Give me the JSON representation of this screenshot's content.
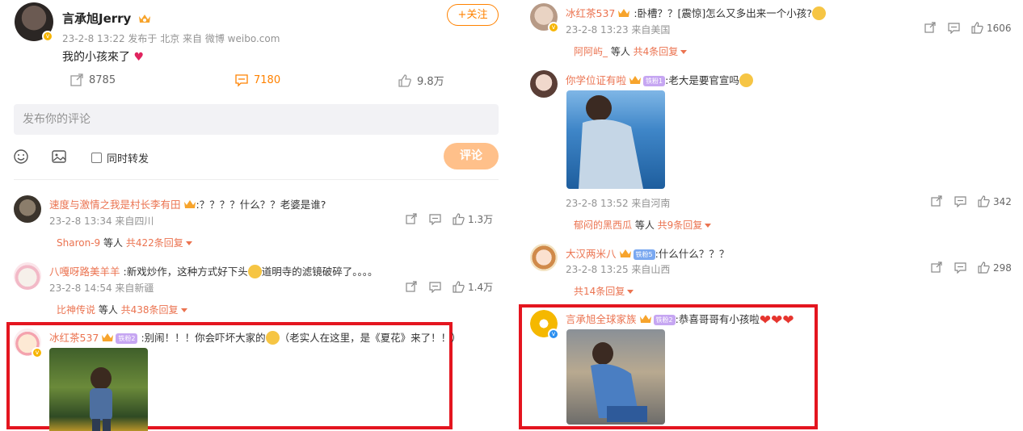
{
  "post": {
    "username": "言承旭Jerry",
    "meta": "23-2-8 13:22  发布于 北京  来自 微博 weibo.com",
    "text": "我的小孩來了",
    "follow_label": "+关注",
    "reposts": "8785",
    "comments": "7180",
    "likes": "9.8万"
  },
  "composer": {
    "placeholder": "发布你的评论",
    "repost_label": "同时转发",
    "submit_label": "评论"
  },
  "left_comments": [
    {
      "user": "速度与激情之我是村长李有田",
      "text": ":？？？？什么？？老婆是谁?",
      "meta": "23-2-8 13:34 来自四川",
      "likes": "1.3万",
      "reply_user": "Sharon-9",
      "reply_mid": " 等人 ",
      "reply_count": "共422条回复"
    },
    {
      "user": "八嘎呀路美羊羊",
      "text_before": ":新戏炒作，这种方式好下头",
      "text_after": "道明寺的滤镜破碎了。。。。",
      "meta": "23-2-8 14:54 来自新疆",
      "likes": "1.4万",
      "reply_user": "比神传说",
      "reply_mid": " 等人 ",
      "reply_count": "共438条回复"
    },
    {
      "user": "冰红茶537",
      "badge": "铁粉2",
      "text_before": ":别闹！！！你会吓坏大家的",
      "text_after": "（老实人在这里，是《夏花》来了！！）"
    }
  ],
  "right_comments": [
    {
      "user": "冰红茶537",
      "text": ":卧槽？？[震惊]怎么又多出来一个小孩?",
      "meta": "23-2-8 13:23 来自美国",
      "likes": "1606",
      "reply_user": "阿阿屿_",
      "reply_mid": " 等人 ",
      "reply_count": "共4条回复"
    },
    {
      "user": "你学位证有啦",
      "badge": "铁粉1",
      "text": ":老大是要官宣吗",
      "meta": "23-2-8 13:52 来自河南",
      "likes": "342",
      "reply_user": "郁闷的黑西瓜",
      "reply_mid": " 等人 ",
      "reply_count": "共9条回复"
    },
    {
      "user": "大汉两米八",
      "badge": "铁粉5",
      "text": ":什么什么？？？",
      "meta": "23-2-8 13:25 来自山西",
      "likes": "298",
      "reply_count": "共14条回复"
    },
    {
      "user": "言承旭全球家族",
      "badge": "铁粉2",
      "text": ":恭喜哥哥有小孩啦"
    }
  ],
  "colors": {
    "accent": "#ff8200",
    "username": "#eb7350",
    "highlight": "#e4151f"
  }
}
